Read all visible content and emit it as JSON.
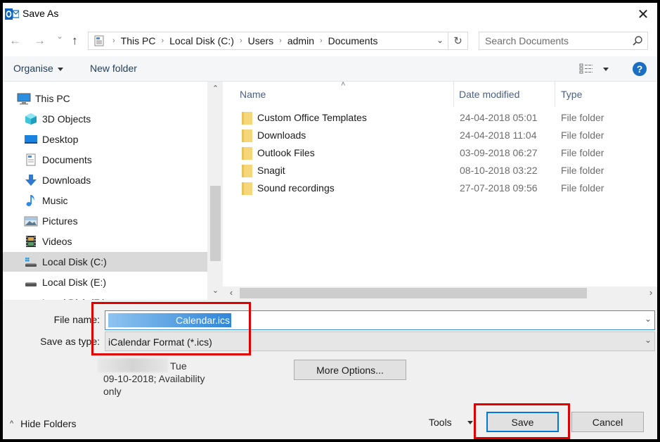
{
  "window": {
    "title": "Save As",
    "app_icon": "outlook-icon",
    "close_icon": "close-icon",
    "close_glyph": "✕"
  },
  "navigation": {
    "back_glyph": "←",
    "forward_glyph": "→",
    "recent_glyph": "⌄",
    "up_glyph": "↑",
    "breadcrumb": [
      "This PC",
      "Local Disk (C:)",
      "Users",
      "admin",
      "Documents"
    ],
    "separator_glyph": "›",
    "dropdown_glyph": "⌄",
    "refresh_glyph": "↻",
    "search_placeholder": "Search Documents"
  },
  "toolbar": {
    "organise_label": "Organise",
    "new_folder_label": "New folder",
    "help_glyph": "?"
  },
  "nav_pane": {
    "items": [
      {
        "label": "This PC",
        "icon": "computer-icon",
        "level": 0,
        "selected": false
      },
      {
        "label": "3D Objects",
        "icon": "cube-icon",
        "level": 1,
        "selected": false
      },
      {
        "label": "Desktop",
        "icon": "desktop-icon",
        "level": 1,
        "selected": false
      },
      {
        "label": "Documents",
        "icon": "document-icon",
        "level": 1,
        "selected": false
      },
      {
        "label": "Downloads",
        "icon": "download-arrow-icon",
        "level": 1,
        "selected": false
      },
      {
        "label": "Music",
        "icon": "music-note-icon",
        "level": 1,
        "selected": false
      },
      {
        "label": "Pictures",
        "icon": "picture-icon",
        "level": 1,
        "selected": false
      },
      {
        "label": "Videos",
        "icon": "film-icon",
        "level": 1,
        "selected": false
      },
      {
        "label": "Local Disk (C:)",
        "icon": "windows-drive-icon",
        "level": 1,
        "selected": true
      },
      {
        "label": "Local Disk (E:)",
        "icon": "drive-icon",
        "level": 1,
        "selected": false
      },
      {
        "label": "Local Disk (F:)",
        "icon": "drive-icon",
        "level": 1,
        "selected": false
      }
    ],
    "scroll_up_glyph": "⌃",
    "scroll_down_glyph": "⌄"
  },
  "file_list": {
    "columns": {
      "name": "Name",
      "date": "Date modified",
      "type": "Type"
    },
    "sort_glyph": "˄",
    "rows": [
      {
        "name": "Custom Office Templates",
        "date": "24-04-2018 05:01",
        "type": "File folder"
      },
      {
        "name": "Downloads",
        "date": "24-04-2018 11:04",
        "type": "File folder"
      },
      {
        "name": "Outlook Files",
        "date": "03-09-2018 06:27",
        "type": "File folder"
      },
      {
        "name": "Snagit",
        "date": "08-10-2018 03:22",
        "type": "File folder"
      },
      {
        "name": "Sound recordings",
        "date": "27-07-2018 09:56",
        "type": "File folder"
      }
    ],
    "scroll_left_glyph": "‹",
    "scroll_right_glyph": "›"
  },
  "form": {
    "file_name_label": "File name:",
    "file_name_value": "Calendar.ics",
    "save_type_label": "Save as type:",
    "save_type_value": "iCalendar Format (*.ics)",
    "chevron_glyph": "⌄",
    "meta_line1": "Tue",
    "meta_line2": "09-10-2018; Availability",
    "meta_line3": "only",
    "more_options_label": "More Options..."
  },
  "footer": {
    "hide_folders_label": "Hide Folders",
    "hide_folders_glyph": "^",
    "tools_label": "Tools",
    "save_label": "Save",
    "cancel_label": "Cancel"
  },
  "annotations": {
    "highlight_color": "#e00000"
  }
}
